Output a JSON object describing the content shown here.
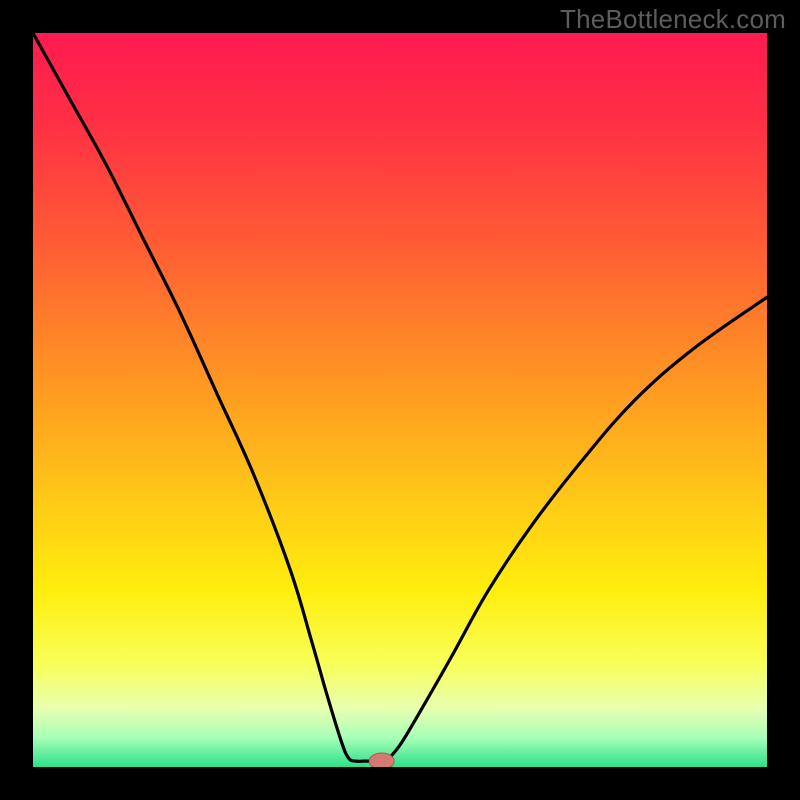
{
  "watermark": "TheBottleneck.com",
  "colors": {
    "frame": "#000000",
    "watermark": "#5d5d5d",
    "curve": "#000000",
    "marker_fill": "#d57a72",
    "marker_stroke": "#b4584f",
    "gradient_stops": [
      {
        "offset": 0.0,
        "color": "#ff1a50"
      },
      {
        "offset": 0.12,
        "color": "#ff2f45"
      },
      {
        "offset": 0.28,
        "color": "#ff5a35"
      },
      {
        "offset": 0.45,
        "color": "#ff8f25"
      },
      {
        "offset": 0.62,
        "color": "#ffc418"
      },
      {
        "offset": 0.76,
        "color": "#ffee0e"
      },
      {
        "offset": 0.86,
        "color": "#f8ff5a"
      },
      {
        "offset": 0.92,
        "color": "#e8ffb0"
      },
      {
        "offset": 0.96,
        "color": "#a8ffb8"
      },
      {
        "offset": 1.0,
        "color": "#2de08a"
      }
    ]
  },
  "chart_data": {
    "type": "line",
    "title": "",
    "xlabel": "",
    "ylabel": "",
    "xlim": [
      0,
      100
    ],
    "ylim": [
      0,
      100
    ],
    "grid": false,
    "legend": false,
    "series": [
      {
        "name": "bottleneck-curve-left",
        "x": [
          0,
          5,
          10,
          15,
          20,
          25,
          30,
          35,
          38,
          40,
          42,
          43,
          44
        ],
        "y": [
          100,
          91,
          82,
          72,
          62,
          51,
          40,
          27,
          17,
          10,
          3.5,
          1.2,
          0.8
        ]
      },
      {
        "name": "bottleneck-curve-flat",
        "x": [
          44,
          45,
          46,
          47,
          48
        ],
        "y": [
          0.8,
          0.8,
          0.8,
          0.8,
          0.8
        ]
      },
      {
        "name": "bottleneck-curve-right",
        "x": [
          48,
          50,
          53,
          57,
          62,
          68,
          75,
          82,
          90,
          100
        ],
        "y": [
          0.8,
          3,
          8,
          15,
          24,
          33,
          42,
          50,
          57,
          64
        ]
      }
    ],
    "marker": {
      "x": 47.5,
      "y": 0.8,
      "rx": 1.7,
      "ry": 1.1
    }
  }
}
